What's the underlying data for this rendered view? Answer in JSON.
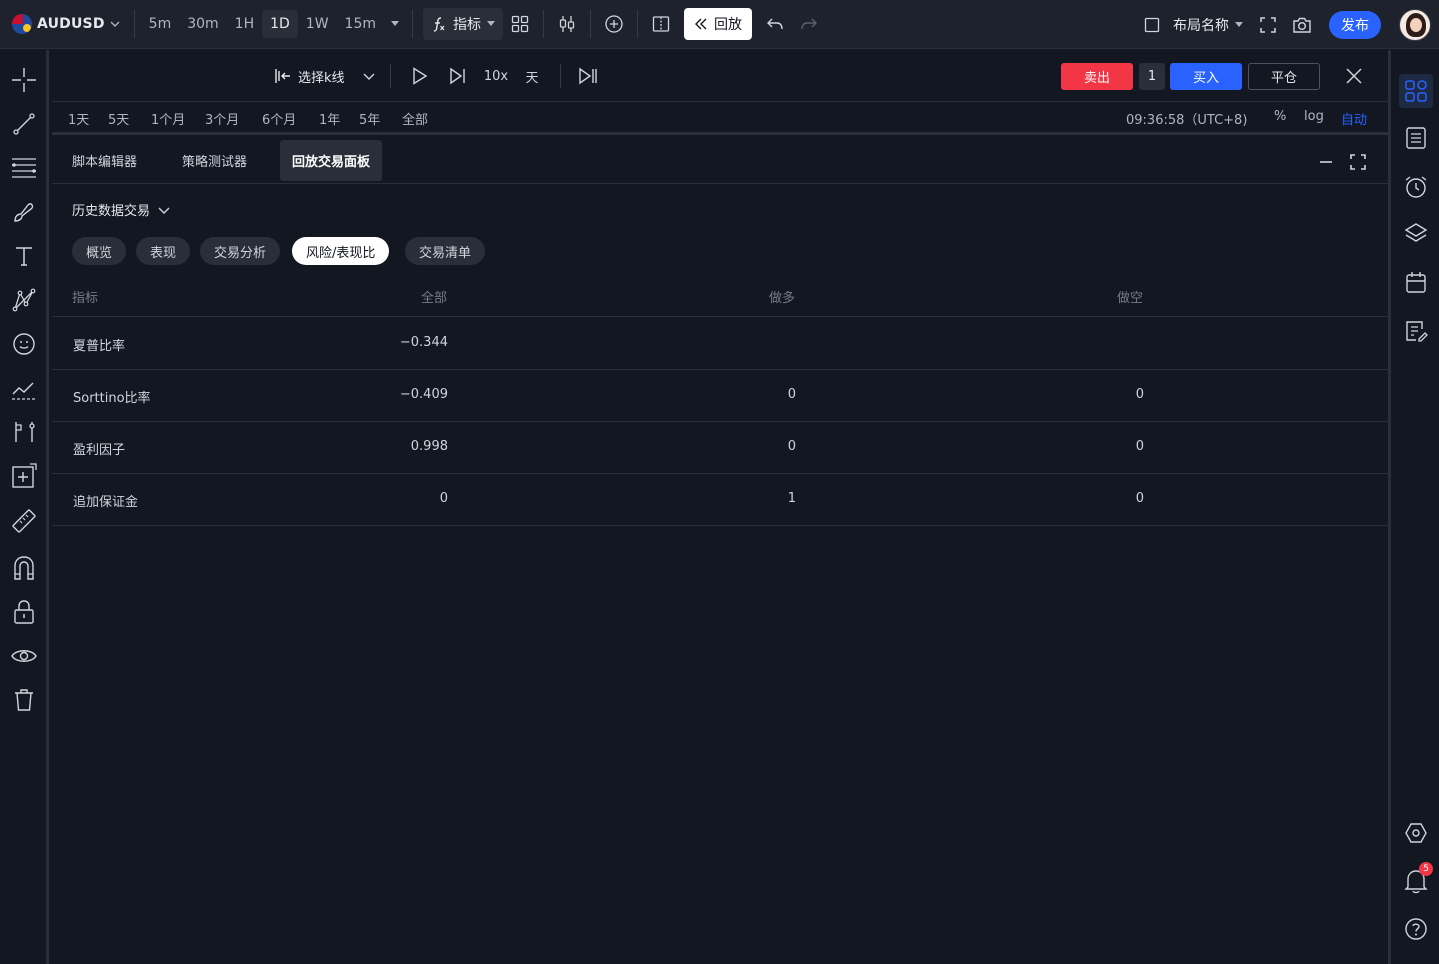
{
  "topbar": {
    "symbol": "AUDUSD",
    "intervals": [
      {
        "label": "5m",
        "active": false
      },
      {
        "label": "30m",
        "active": false
      },
      {
        "label": "1H",
        "active": false
      },
      {
        "label": "1D",
        "active": true
      },
      {
        "label": "1W",
        "active": false
      },
      {
        "label": "15m",
        "active": false
      }
    ],
    "indicators_label": "指标",
    "replay_label": "回放",
    "layout_name": "布局名称",
    "publish_label": "发布"
  },
  "replay_bar": {
    "select_bar_label": "选择k线",
    "speed": "10x",
    "step_unit": "天",
    "sell_label": "卖出",
    "quantity": "1",
    "buy_label": "买入",
    "close_position_label": "平仓"
  },
  "range_bar": {
    "ranges": [
      "1天",
      "5天",
      "1个月",
      "3个月",
      "6个月",
      "1年",
      "5年",
      "全部"
    ],
    "clock": "09:36:58（UTC+8)",
    "scale_percent": "%",
    "scale_log": "log",
    "scale_auto": "自动"
  },
  "panel": {
    "tabs": [
      "脚本编辑器",
      "策略测试器",
      "回放交易面板"
    ],
    "active_tab": "回放交易面板",
    "section_label": "历史数据交易",
    "subtabs": [
      "概览",
      "表现",
      "交易分析",
      "风险/表现比",
      "交易清单"
    ],
    "active_subtab": "风险/表现比"
  },
  "table": {
    "columns": [
      "指标",
      "全部",
      "做多",
      "做空"
    ],
    "rows": [
      {
        "name": "夏普比率",
        "all": "−0.344",
        "long": "",
        "short": ""
      },
      {
        "name": "Sorttino比率",
        "all": "−0.409",
        "long": "0",
        "short": "0"
      },
      {
        "name": "盈利因子",
        "all": "0.998",
        "long": "0",
        "short": "0"
      },
      {
        "name": "追加保证金",
        "all": "0",
        "long": "1",
        "short": "0"
      }
    ]
  },
  "notifications": {
    "count": "5"
  },
  "colors": {
    "accent": "#2962ff",
    "sell": "#f23645",
    "background": "#131722"
  }
}
